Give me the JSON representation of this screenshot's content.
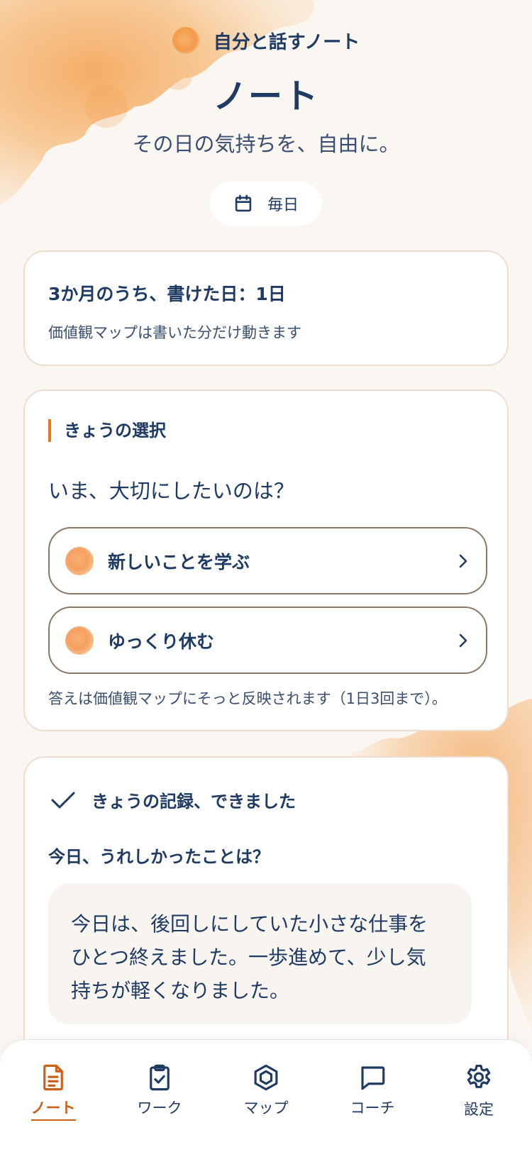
{
  "header": {
    "app_name": "自分と話すノート",
    "title": "ノート",
    "subtitle": "その日の気持ちを、自由に。",
    "frequency_label": "毎日"
  },
  "summary": {
    "count_text": "3か月のうち、書けた日：1日",
    "description": "価値観マップは書いた分だけ動きます"
  },
  "choice_section": {
    "label": "きょうの選択",
    "question": "いま、大切にしたいのは？",
    "options": [
      {
        "label": "新しいことを学ぶ"
      },
      {
        "label": "ゆっくり休む"
      }
    ],
    "note": "答えは価値観マップにそっと反映されます（1日3回まで）。"
  },
  "record": {
    "status": "きょうの記録、できました",
    "prompt": "今日、うれしかったことは？",
    "answer_lines": [
      "今日は、後回しにしていた小さな仕事を",
      "ひとつ終えました。一歩進めて、少し気",
      "持ちが軽くなりました。"
    ]
  },
  "tabs": [
    {
      "label": "ノート",
      "icon": "document-icon",
      "active": true
    },
    {
      "label": "ワーク",
      "icon": "clipboard-check-icon",
      "active": false
    },
    {
      "label": "マップ",
      "icon": "hexagon-icon",
      "active": false
    },
    {
      "label": "コーチ",
      "icon": "chat-bubble-icon",
      "active": false
    },
    {
      "label": "設定",
      "icon": "gear-icon",
      "active": false
    }
  ],
  "colors": {
    "primary_text": "#1f3a63",
    "accent": "#c8621a",
    "background": "#faf7f3",
    "watercolor": "#f6b36a"
  }
}
